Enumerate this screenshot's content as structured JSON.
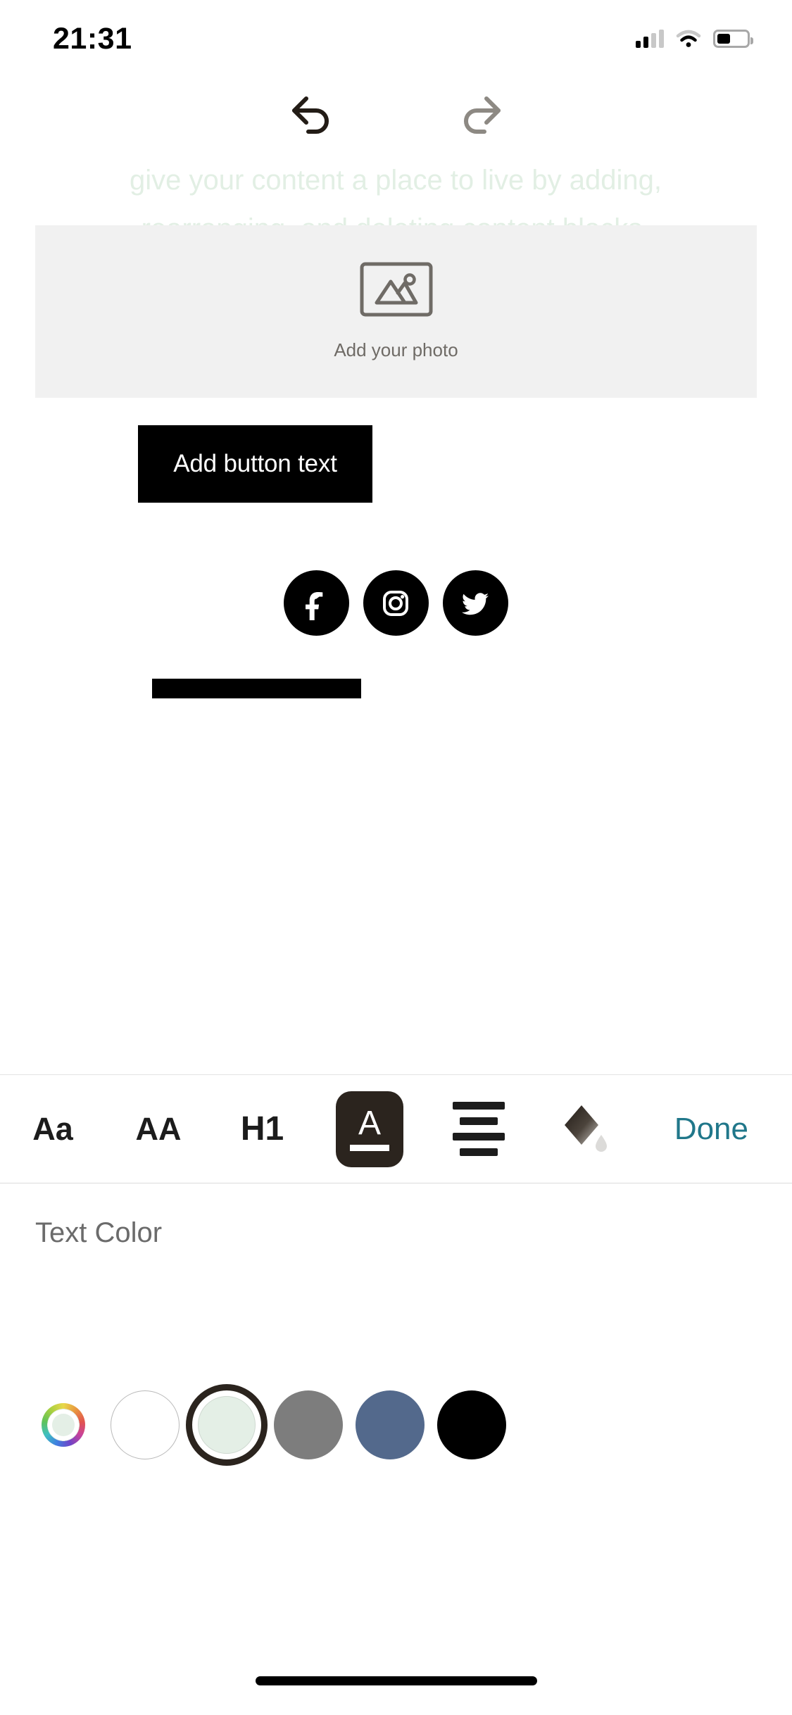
{
  "status_bar": {
    "time": "21:31",
    "cellular_icon": "cellular-signal-icon",
    "wifi_icon": "wifi-icon",
    "battery_icon": "battery-icon",
    "signal_bars_filled": 2,
    "signal_bars_total": 4,
    "battery_level_percent": 40
  },
  "history_bar": {
    "undo": {
      "icon": "undo-arrow-icon",
      "label": "Undo",
      "enabled": true,
      "color": "#231c16"
    },
    "redo": {
      "icon": "redo-arrow-icon",
      "label": "Redo",
      "enabled": false,
      "color": "#8d8983"
    }
  },
  "canvas": {
    "paragraph": {
      "text": "give your content a place to live by adding,\nrearranging, and deleting content blocks.",
      "color": "#e2efe4"
    },
    "photo_block": {
      "icon": "image-placeholder-icon",
      "label": "Add your photo",
      "background": "#f1f1f1",
      "label_color": "#6f6b66"
    },
    "cta_button": {
      "label": "Add button text",
      "background": "#000000",
      "text_color": "#ffffff"
    },
    "social_links": [
      {
        "name": "facebook",
        "icon": "facebook-icon"
      },
      {
        "name": "instagram",
        "icon": "instagram-icon"
      },
      {
        "name": "twitter",
        "icon": "twitter-icon"
      }
    ],
    "divider_block": {
      "color": "#000000"
    }
  },
  "format_toolbar": {
    "items": [
      {
        "id": "font-family",
        "label": "Aa",
        "icon": "font-family-icon",
        "selected": false
      },
      {
        "id": "font-size",
        "label": "AA",
        "icon": "font-size-icon",
        "selected": false
      },
      {
        "id": "heading",
        "label": "H1",
        "icon": "heading-one-icon",
        "selected": false
      },
      {
        "id": "text-color",
        "label": "A",
        "icon": "text-color-icon",
        "selected": true
      },
      {
        "id": "alignment",
        "label": "",
        "icon": "text-align-icon",
        "selected": false
      },
      {
        "id": "fill-color",
        "label": "",
        "icon": "paint-bucket-icon",
        "selected": false
      }
    ],
    "done_label": "Done",
    "done_color": "#20778a",
    "selected_background": "#2b241e"
  },
  "color_panel": {
    "title": "Text Color",
    "swatches": [
      {
        "name": "custom-color-wheel",
        "type": "wheel",
        "current": "#e4efe6",
        "selected": false
      },
      {
        "name": "white",
        "type": "solid",
        "color": "#ffffff",
        "selected": false
      },
      {
        "name": "pale-green",
        "type": "solid",
        "color": "#e4efe6",
        "selected": true
      },
      {
        "name": "gray",
        "type": "solid",
        "color": "#7d7d7d",
        "selected": false
      },
      {
        "name": "slate-blue",
        "type": "solid",
        "color": "#53698c",
        "selected": false
      },
      {
        "name": "black",
        "type": "solid",
        "color": "#000000",
        "selected": false
      }
    ]
  },
  "home_indicator": {
    "visible": true
  }
}
